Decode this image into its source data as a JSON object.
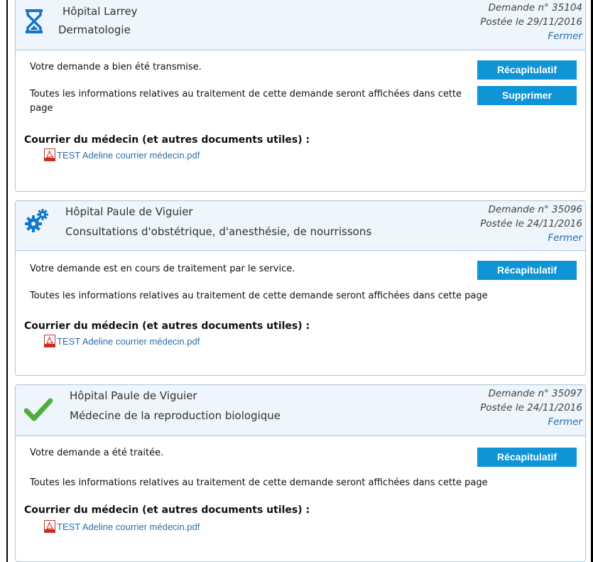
{
  "colors": {
    "accent": "#0f95d6",
    "link": "#2a6ea8",
    "header_bg": "#eef5fc",
    "check_green": "#4caf3d",
    "icon_blue": "#1177c8"
  },
  "requests": [
    {
      "icon": "hourglass-icon",
      "hospital": "Hôpital Larrey",
      "service": "Dermatologie",
      "number": "Demande n° 35104",
      "posted": "Postée le 29/11/2016",
      "close_label": "Fermer",
      "status_message": "Votre demande a bien été transmise.",
      "info_text": "Toutes les informations relatives au traitement de cette demande seront affichées dans cette page",
      "summary_label": "Récapitulatif",
      "delete_label": "Supprimer",
      "documents_title": "Courrier du médecin (et autres documents utiles) :",
      "document_name": "TEST Adeline courrier médecin.pdf"
    },
    {
      "icon": "gears-icon",
      "hospital": "Hôpital Paule de Viguier",
      "service": "Consultations d'obstétrique, d'anesthésie, de nourrissons",
      "number": "Demande n° 35096",
      "posted": "Postée le 24/11/2016",
      "close_label": "Fermer",
      "status_message": "Votre demande est en cours de traitement par le service.",
      "info_text": "Toutes les informations relatives au traitement de cette demande seront affichées dans cette page",
      "summary_label": "Récapitulatif",
      "documents_title": "Courrier du médecin (et autres documents utiles) :",
      "document_name": "TEST Adeline courrier médecin.pdf"
    },
    {
      "icon": "checkmark-icon",
      "hospital": "Hôpital Paule de Viguier",
      "service": "Médecine de la reproduction biologique",
      "number": "Demande n° 35097",
      "posted": "Postée le 24/11/2016",
      "close_label": "Fermer",
      "status_message": "Votre demande a été traitée.",
      "info_text": "Toutes les informations relatives au traitement de cette demande seront affichées dans cette page",
      "summary_label": "Récapitulatif",
      "documents_title": "Courrier du médecin (et autres documents utiles) :",
      "document_name": "TEST Adeline courrier médecin.pdf"
    }
  ]
}
